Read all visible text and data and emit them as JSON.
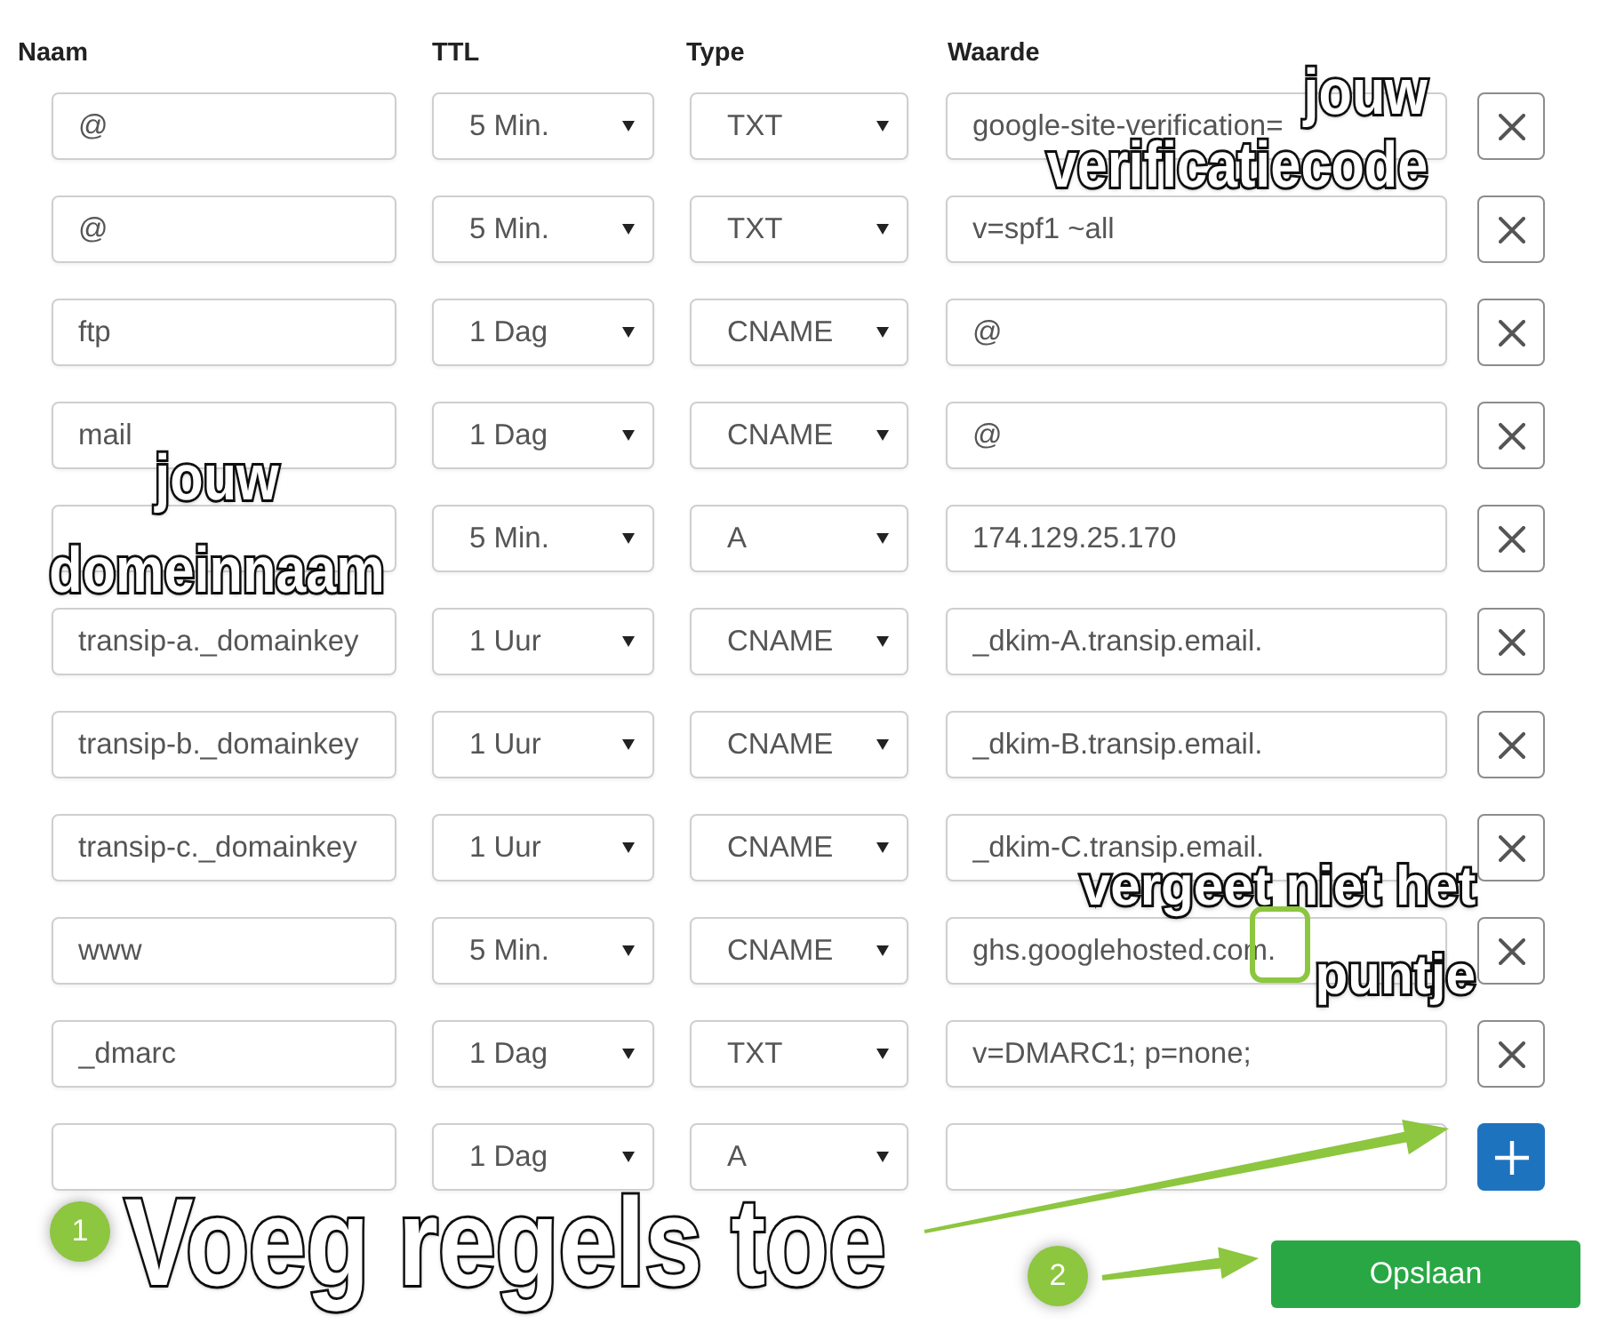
{
  "headers": [
    "Naam",
    "TTL",
    "Type",
    "Waarde"
  ],
  "rows": [
    {
      "kind": "record",
      "name": "@",
      "ttl": "5 Min.",
      "type": "TXT",
      "value": "google-site-verification="
    },
    {
      "kind": "record",
      "name": "@",
      "ttl": "5 Min.",
      "type": "TXT",
      "value": "v=spf1 ~all"
    },
    {
      "kind": "record",
      "name": "ftp",
      "ttl": "1 Dag",
      "type": "CNAME",
      "value": "@"
    },
    {
      "kind": "record",
      "name": "mail",
      "ttl": "1 Dag",
      "type": "CNAME",
      "value": "@"
    },
    {
      "kind": "record",
      "ttl": "5 Min.",
      "type": "A",
      "value": "174.129.25.170"
    },
    {
      "kind": "record",
      "name": "transip-a._domainkey",
      "ttl": "1 Uur",
      "type": "CNAME",
      "value": "_dkim-A.transip.email."
    },
    {
      "kind": "record",
      "name": "transip-b._domainkey",
      "ttl": "1 Uur",
      "type": "CNAME",
      "value": "_dkim-B.transip.email."
    },
    {
      "kind": "record",
      "name": "transip-c._domainkey",
      "ttl": "1 Uur",
      "type": "CNAME",
      "value": "_dkim-C.transip.email."
    },
    {
      "kind": "record",
      "name": "www",
      "ttl": "5 Min.",
      "type": "CNAME",
      "value": "ghs.googlehosted.com."
    },
    {
      "kind": "record",
      "name": "_dmarc",
      "ttl": "1 Dag",
      "type": "TXT",
      "value": "v=DMARC1; p=none;"
    },
    {
      "kind": "new",
      "ttl": "1 Dag",
      "type": "A"
    }
  ],
  "save_button": "Opslaan",
  "callouts": [
    {
      "lines": [
        "jouw",
        "verificatiecode"
      ]
    },
    {
      "lines": [
        "jouw",
        "domeinnaam"
      ]
    },
    {
      "lines": [
        "vergeet niet het",
        "puntje"
      ]
    }
  ],
  "steps": [
    {
      "number": "1",
      "caption": "Voeg regels toe"
    },
    {
      "number": "2"
    }
  ]
}
